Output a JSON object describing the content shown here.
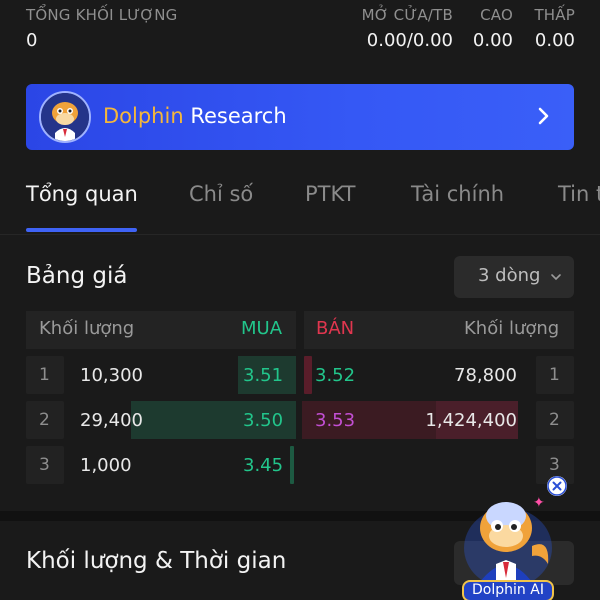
{
  "stats": {
    "total_volume_label": "TỔNG KHỐI LƯỢNG",
    "total_volume_value": "0",
    "open_avg_label": "MỞ CỬA/TB",
    "open_avg_value": "0.00/0.00",
    "high_label": "CAO",
    "high_value": "0.00",
    "low_label": "THẤP",
    "low_value": "0.00"
  },
  "banner": {
    "brand": "Dolphin",
    "title_rest": "Research",
    "avatar_icon": "dolphin-mascot-icon",
    "chevron_icon": "chevron-right-icon"
  },
  "tabs": [
    {
      "label": "Tổng quan",
      "active": true
    },
    {
      "label": "Chỉ số",
      "active": false
    },
    {
      "label": "PTKT",
      "active": false
    },
    {
      "label": "Tài chính",
      "active": false
    },
    {
      "label": "Tin t",
      "active": false
    }
  ],
  "order_book": {
    "title": "Bảng giá",
    "rows_selector": "3 dòng",
    "headers": {
      "buy_volume": "Khối lượng",
      "buy": "MUA",
      "sell": "BÁN",
      "sell_volume": "Khối lượng"
    },
    "rows": [
      {
        "index": "1",
        "buy_volume": "10,300",
        "buy_price": "3.51",
        "sell_price": "3.52",
        "sell_volume": "78,800",
        "sell_index": "1"
      },
      {
        "index": "2",
        "buy_volume": "29,400",
        "buy_price": "3.50",
        "sell_price": "3.53",
        "sell_volume": "1,424,400",
        "sell_index": "2"
      },
      {
        "index": "3",
        "buy_volume": "1,000",
        "buy_price": "3.45",
        "sell_price": "",
        "sell_volume": "",
        "sell_index": "3"
      }
    ]
  },
  "section2": {
    "title": "Khối lượng & Thời gian"
  },
  "assistant": {
    "label": "Dolphin AI",
    "close_icon": "close-icon",
    "mascot_icon": "dolphin-mascot-icon"
  },
  "colors": {
    "accent_blue": "#3f63f5",
    "buy_green": "#22c58b",
    "sell_red": "#e0364f",
    "sell_purple": "#c34fd3",
    "brand_gold": "#f5b73b"
  }
}
